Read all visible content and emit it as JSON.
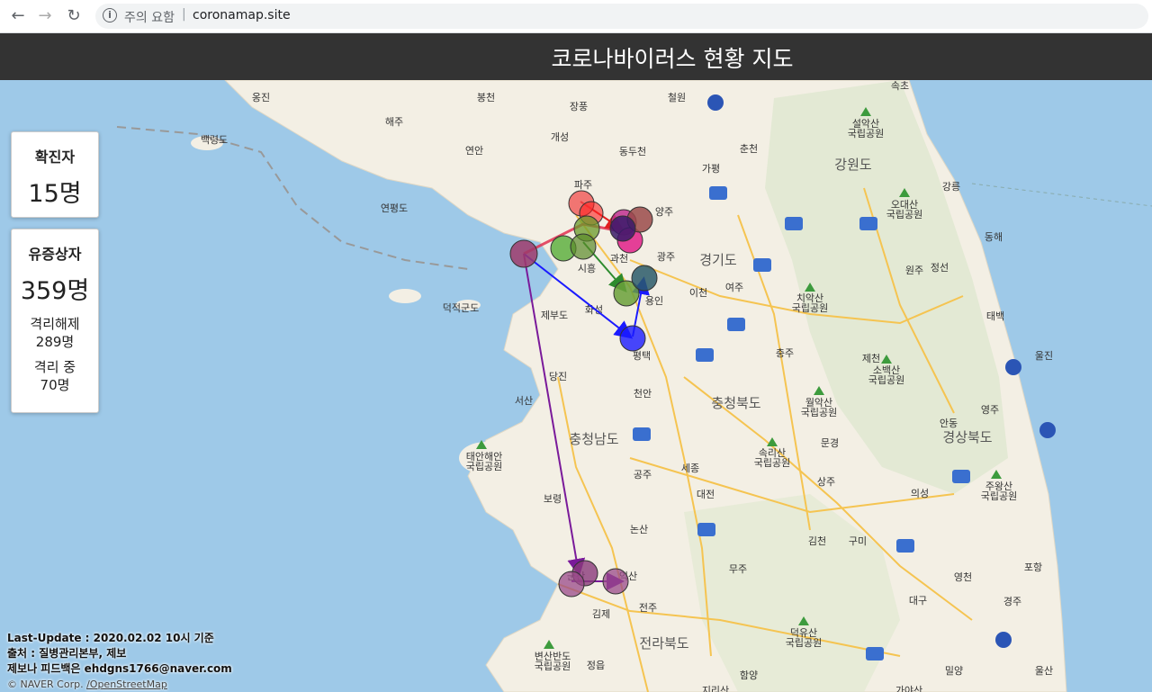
{
  "browser": {
    "back_icon": "arrow-left-icon",
    "forward_icon": "arrow-right-icon",
    "reload_icon": "reload-icon",
    "security_warning": "주의 요함",
    "url": "coronamap.site"
  },
  "header": {
    "title": "코로나바이러스 현황 지도"
  },
  "stats": {
    "confirmed_label": "확진자",
    "confirmed_value": "15명",
    "suspected_label": "유증상자",
    "suspected_value": "359명",
    "released_label": "격리해제",
    "released_value": "289명",
    "isolating_label": "격리 중",
    "isolating_value": "70명"
  },
  "footer": {
    "update": "Last-Update : 2020.02.02 10시 기준",
    "source": "출처 : 질병관리본부, 제보",
    "feedback": "제보나 피드백은 ehdgns1766@naver.com",
    "attribution": "© NAVER Corp.",
    "osm_link": "/OpenStreetMap"
  },
  "map": {
    "places": [
      "옹진",
      "봉천",
      "장풍",
      "철원",
      "해주",
      "개성",
      "연안",
      "동두천",
      "춘천",
      "파주",
      "가평",
      "양주",
      "연평도",
      "백령도",
      "과천",
      "시흥",
      "광주",
      "화성",
      "용인",
      "이천",
      "여주",
      "평택",
      "당진",
      "천안",
      "서산",
      "세종",
      "대전",
      "공주",
      "보령",
      "논산",
      "군산",
      "익산",
      "전주",
      "김제",
      "정읍",
      "함양",
      "충주",
      "제천",
      "원주",
      "강릉",
      "동해",
      "정선",
      "태백",
      "울진",
      "영주",
      "문경",
      "상주",
      "김천",
      "구미",
      "의성",
      "안동",
      "영천",
      "포항",
      "경주",
      "대구",
      "밀양",
      "울산",
      "무주",
      "속초",
      "덕적군도",
      "제부도"
    ],
    "regions": [
      "경기도",
      "강원도",
      "충청북도",
      "충청남도",
      "경상북도",
      "전라북도"
    ],
    "parks": [
      "설악산 국립공원",
      "오대산 국립공원",
      "치악산 국립공원",
      "월악산 국립공원",
      "소백산 국립공원",
      "속리산 국립공원",
      "주왕산 국립공원",
      "태안해안 국립공원",
      "덕유산 국립공원",
      "변산반도 국립공원",
      "지리산 국립공원",
      "가야산 국립공원"
    ]
  }
}
